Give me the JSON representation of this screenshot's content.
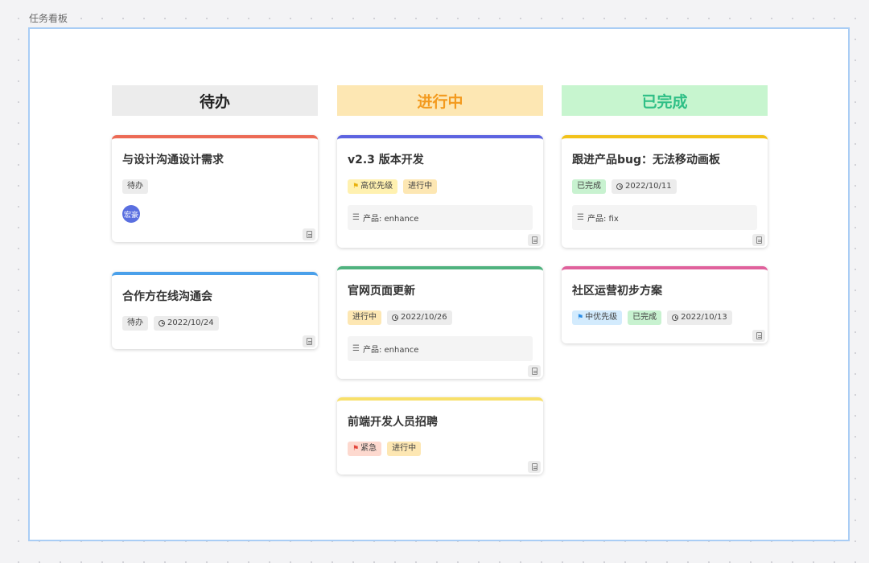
{
  "frame": {
    "label": "任务看板"
  },
  "columns": [
    {
      "title": "待办",
      "cards": [
        {
          "title": "与设计沟通设计需求",
          "accent": "#ec6a55",
          "status": "待办",
          "assignee": "宏豪"
        },
        {
          "title": "合作方在线沟通会",
          "accent": "#4aa0ea",
          "status": "待办",
          "date": "2022/10/24"
        }
      ]
    },
    {
      "title": "进行中",
      "cards": [
        {
          "title": "v2.3 版本开发",
          "accent": "#5c63e0",
          "priority": "高优先级",
          "status": "进行中",
          "info": "产品: enhance"
        },
        {
          "title": "官网页面更新",
          "accent": "#4fb27e",
          "status": "进行中",
          "date": "2022/10/26",
          "info": "产品: enhance"
        },
        {
          "title": "前端开发人员招聘",
          "accent": "#f8e06a",
          "priority": "紧急",
          "status": "进行中"
        }
      ]
    },
    {
      "title": "已完成",
      "cards": [
        {
          "title": "跟进产品bug：无法移动画板",
          "accent": "#f2c21a",
          "status": "已完成",
          "date": "2022/10/11",
          "info": "产品: fix"
        },
        {
          "title": "社区运营初步方案",
          "accent": "#e0619c",
          "priority": "中优先级",
          "status": "已完成",
          "date": "2022/10/13"
        }
      ]
    }
  ],
  "icons": {
    "flag": "flag-icon",
    "clock": "clock-icon",
    "lines": "lines-icon",
    "document": "document-icon"
  }
}
